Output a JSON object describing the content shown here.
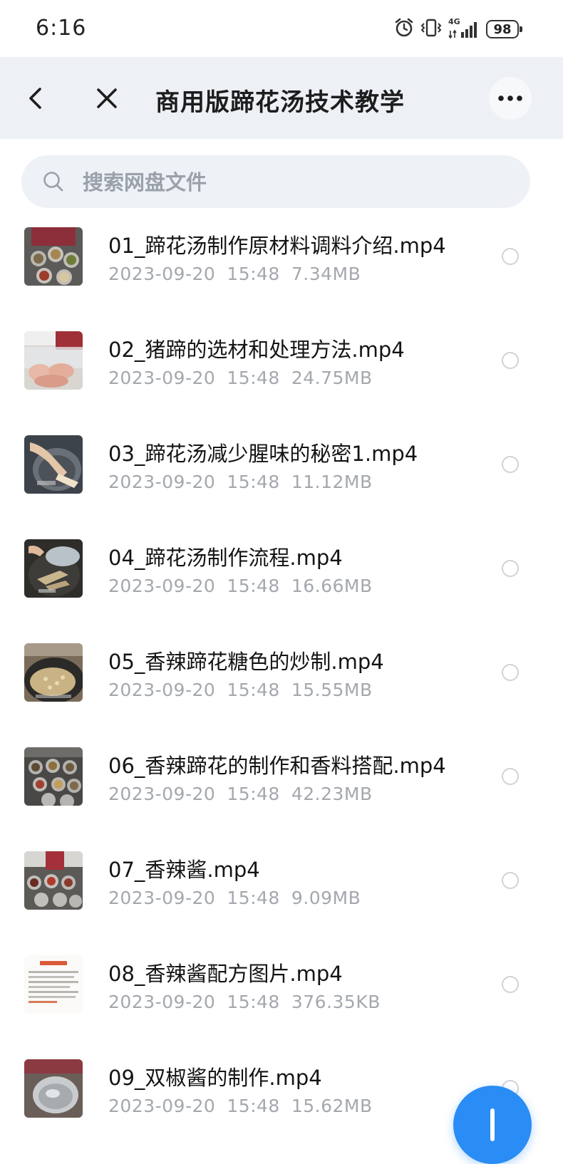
{
  "status": {
    "time": "6:16",
    "network": "4G",
    "battery": "98"
  },
  "header": {
    "title": "商用版蹄花汤技术教学",
    "icons": [
      "back-arrow-icon",
      "close-icon",
      "more-icon"
    ]
  },
  "search": {
    "placeholder": "搜索网盘文件"
  },
  "files": [
    {
      "name": "01_蹄花汤制作原材料调料介绍.mp4",
      "date": "2023-09-20",
      "time": "15:48",
      "size": "7.34MB"
    },
    {
      "name": "02_猪蹄的选材和处理方法.mp4",
      "date": "2023-09-20",
      "time": "15:48",
      "size": "24.75MB"
    },
    {
      "name": "03_蹄花汤减少腥味的秘密1.mp4",
      "date": "2023-09-20",
      "time": "15:48",
      "size": "11.12MB"
    },
    {
      "name": "04_蹄花汤制作流程.mp4",
      "date": "2023-09-20",
      "time": "15:48",
      "size": "16.66MB"
    },
    {
      "name": "05_香辣蹄花糖色的炒制.mp4",
      "date": "2023-09-20",
      "time": "15:48",
      "size": "15.55MB"
    },
    {
      "name": "06_香辣蹄花的制作和香料搭配.mp4",
      "date": "2023-09-20",
      "time": "15:48",
      "size": "42.23MB"
    },
    {
      "name": "07_香辣酱.mp4",
      "date": "2023-09-20",
      "time": "15:48",
      "size": "9.09MB"
    },
    {
      "name": "08_香辣酱配方图片.mp4",
      "date": "2023-09-20",
      "time": "15:48",
      "size": "376.35KB"
    },
    {
      "name": "09_双椒酱的制作.mp4",
      "date": "2023-09-20",
      "time": "15:48",
      "size": "15.62MB"
    }
  ],
  "colors": {
    "header_bg": "#edf0f5",
    "search_bg": "#eef1f6",
    "meta_text": "#a4a8ae",
    "fab": "#2a8cf5"
  }
}
